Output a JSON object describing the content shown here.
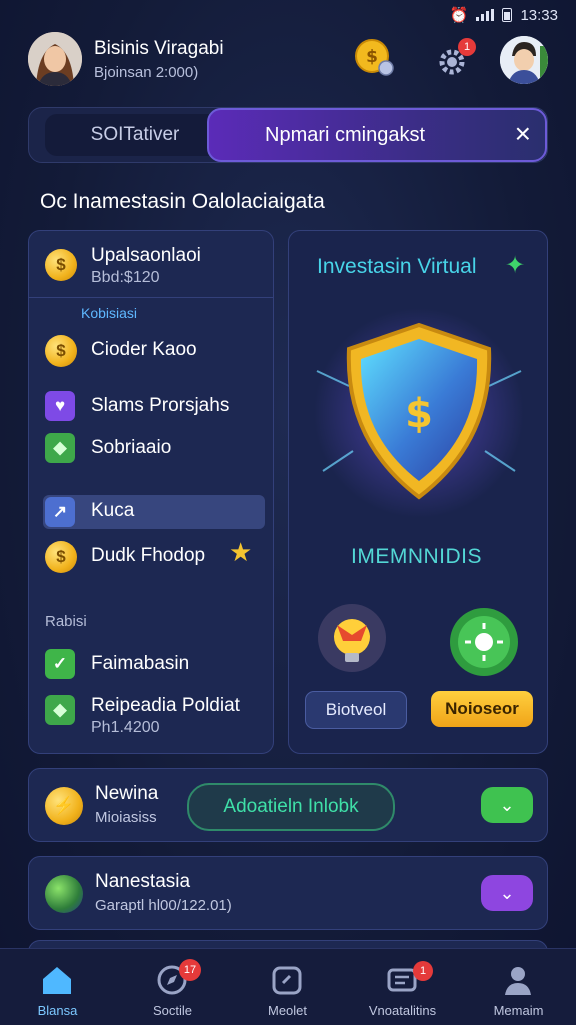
{
  "status": {
    "time": "13:33"
  },
  "header": {
    "name": "Bisinis Viragabi",
    "sub": "Bjoinsan 2:000)",
    "badge_count": "1"
  },
  "search": {
    "segment_left": "SOITativer",
    "segment_right": "Npmari cmingakst",
    "close_icon": "×"
  },
  "section_title": "Oc Inamestasin Oalolaciaigata",
  "left_panel": {
    "top_item": {
      "label": "Upalsaonlaoi",
      "value": "Bbd:$120"
    },
    "group1_label": "Kobisiasi",
    "group1_items": [
      {
        "label": "Cioder Kaoo",
        "icon": "dollar-coin-icon"
      },
      {
        "label": "Slams Prorsjahs",
        "icon": "heart-icon"
      },
      {
        "label": "Sobriaaio",
        "icon": "cube-icon"
      },
      {
        "label": "Kuca",
        "icon": "chart-icon"
      },
      {
        "label": "Dudk Fhodop",
        "icon": "dollar-coin-icon"
      }
    ],
    "group2_label": "Rabisi",
    "group2_items": [
      {
        "label": "Faimabasin",
        "icon": "check-icon"
      },
      {
        "label": "Reipeadia Poldiat",
        "value": "Ph1.4200",
        "icon": "cube-icon"
      }
    ]
  },
  "right_panel": {
    "title": "Investasin Virtual",
    "caption": "IMEMNNIDIS",
    "btn_left": "Biotveol",
    "btn_right": "Noioseor"
  },
  "rows": [
    {
      "title": "Newina",
      "sub": "Mioiasiss",
      "pill": "Adoatieln Inlobk"
    },
    {
      "title": "Nanestasia",
      "sub": "Garaptl hl00/122.01)"
    }
  ],
  "tabs": [
    {
      "label": "Blansa",
      "icon": "home-icon"
    },
    {
      "label": "Soctile",
      "icon": "compass-icon",
      "badge": "17"
    },
    {
      "label": "Meolet",
      "icon": "wallet-icon"
    },
    {
      "label": "Vnoatalitins",
      "icon": "message-icon",
      "badge": "1"
    },
    {
      "label": "Memaim",
      "icon": "profile-icon"
    }
  ],
  "colors": {
    "accent": "#5b2bb8",
    "cyan": "#48d4e8",
    "green": "#38c65a",
    "badge": "#e53a3a"
  }
}
